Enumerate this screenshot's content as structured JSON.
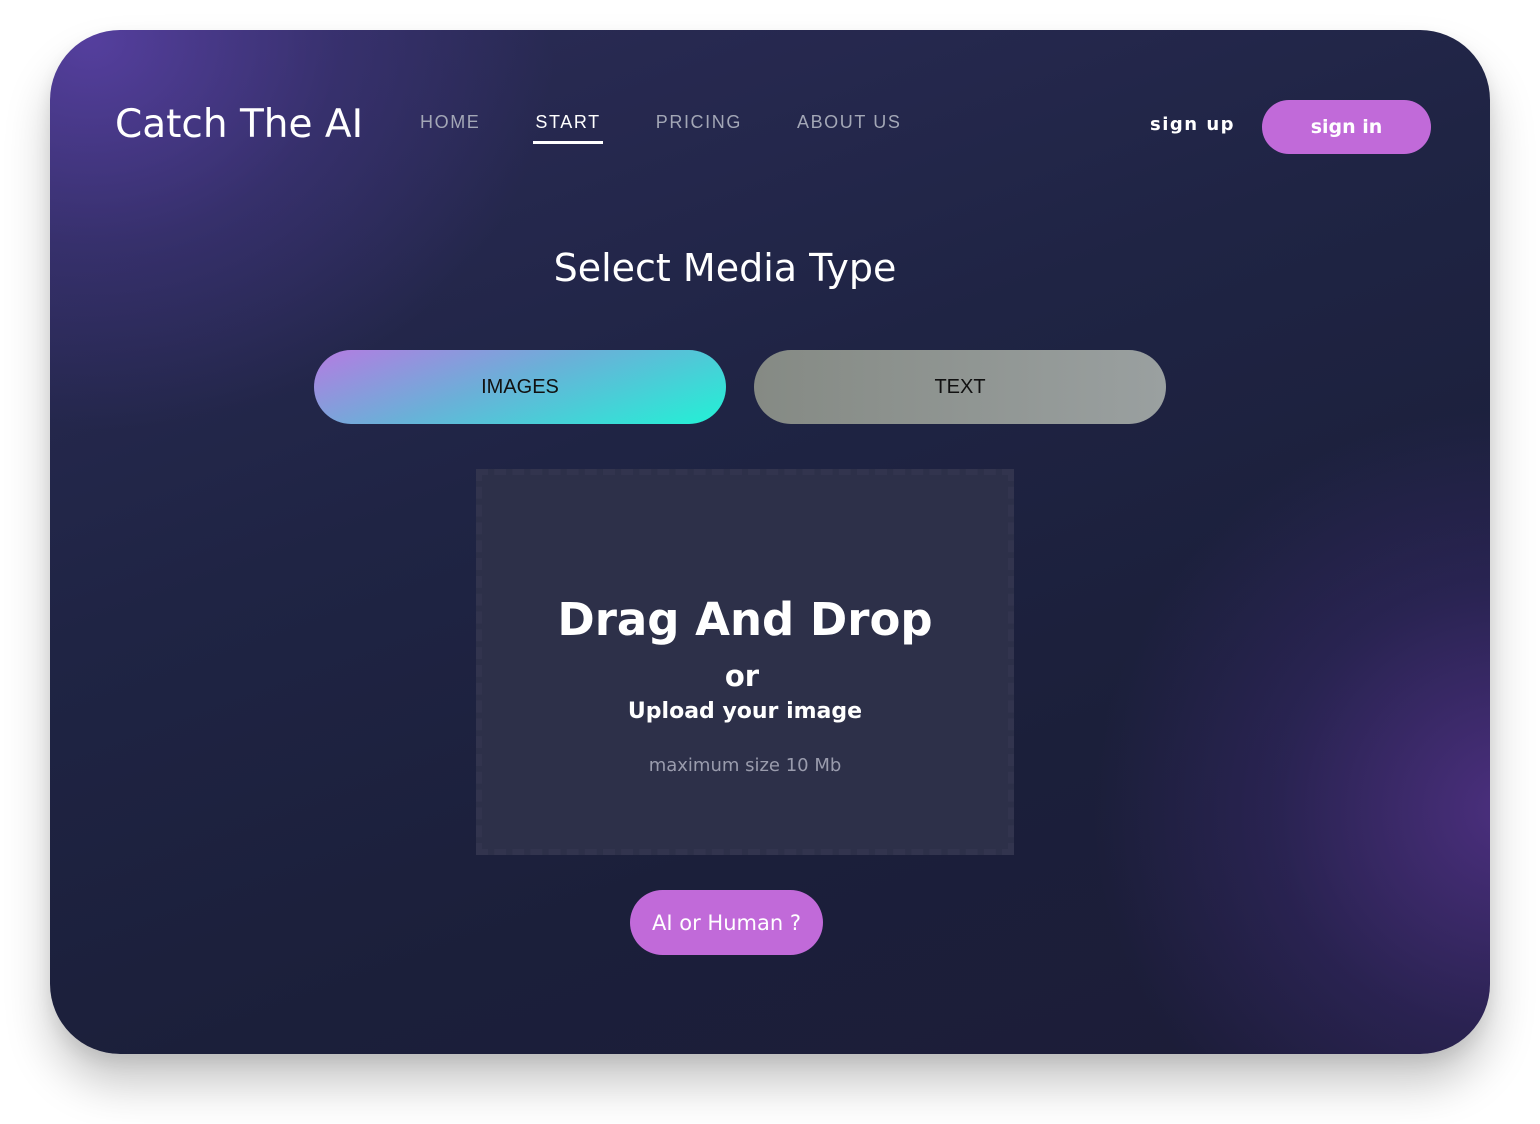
{
  "header": {
    "logo": "Catch The AI",
    "nav": [
      {
        "label": "HOME",
        "active": false
      },
      {
        "label": "START",
        "active": true
      },
      {
        "label": "PRICING",
        "active": false
      },
      {
        "label": "ABOUT US",
        "active": false
      }
    ],
    "signup_label": "sign up",
    "signin_label": "sign in"
  },
  "main": {
    "title": "Select Media Type",
    "tabs": [
      {
        "label": "IMAGES",
        "selected": true
      },
      {
        "label": "TEXT",
        "selected": false
      }
    ],
    "dropzone": {
      "heading": "Drag And Drop",
      "or": "or",
      "upload": "Upload your image",
      "max_size": "maximum size 10 Mb"
    },
    "action_label": "AI or Human ?"
  },
  "colors": {
    "accent": "#c16ad9",
    "images_gradient_start": "#b57be2",
    "images_gradient_end": "#21f2d6",
    "text_tab": "#8f948f",
    "background": "#1f2444"
  }
}
